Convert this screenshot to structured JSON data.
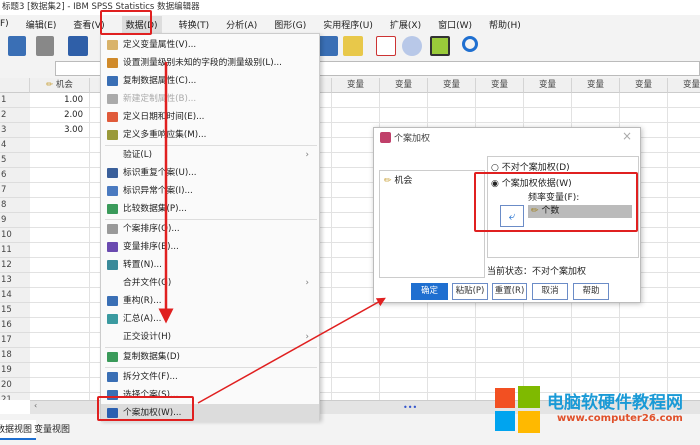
{
  "title": "标题3 [数据集2] - IBM SPSS Statistics 数据编辑器",
  "menubar": [
    "F)",
    "编辑(E)",
    "查看(V)",
    "数据(D)",
    "转换(T)",
    "分析(A)",
    "图形(G)",
    "实用程序(U)",
    "扩展(X)",
    "窗口(W)",
    "帮助(H)"
  ],
  "grid": {
    "col1": "机会",
    "var_label": "变量",
    "rows": [
      "1",
      "2",
      "3",
      "4",
      "5",
      "6",
      "7",
      "8",
      "9",
      "10",
      "11",
      "12",
      "13",
      "14",
      "15",
      "16",
      "17",
      "18",
      "19",
      "20",
      "21"
    ],
    "values": [
      "1.00",
      "2.00",
      "3.00"
    ]
  },
  "data_menu": {
    "items": [
      {
        "label": "定义变量属性(V)...",
        "icon": "define-variable-icon",
        "color": "#d9b36a"
      },
      {
        "label": "设置测量级别未知的字段的测量级别(L)...",
        "icon": "measurement-level-icon",
        "color": "#d08a2a"
      },
      {
        "label": "复制数据属性(C)...",
        "icon": "copy-properties-icon",
        "color": "#3a6fb5"
      },
      {
        "label": "新建定制属性(B)...",
        "icon": "custom-attribute-icon",
        "color": "#aaa",
        "disabled": true
      },
      {
        "label": "定义日期和时间(E)...",
        "icon": "date-time-icon",
        "color": "#e05a3a"
      },
      {
        "label": "定义多重响应集(M)...",
        "icon": "multiple-response-icon",
        "color": "#9a9a3a"
      },
      {
        "label": "验证(L)",
        "submenu": true
      },
      {
        "label": "标识重复个案(U)...",
        "icon": "duplicate-cases-icon",
        "color": "#3a5f9a"
      },
      {
        "label": "标识异常个案(I)...",
        "icon": "unusual-cases-icon",
        "color": "#4a7ac0"
      },
      {
        "label": "比较数据集(P)...",
        "icon": "compare-datasets-icon",
        "color": "#3a9a5a"
      },
      {
        "label": "个案排序(O)...",
        "icon": "sort-cases-icon",
        "color": "#999"
      },
      {
        "label": "变量排序(B)...",
        "icon": "sort-variables-icon",
        "color": "#6a4ab0"
      },
      {
        "label": "转置(N)...",
        "icon": "transpose-icon",
        "color": "#3a8a9a"
      },
      {
        "label": "合并文件(G)",
        "submenu": true
      },
      {
        "label": "重构(R)...",
        "icon": "restructure-icon",
        "color": "#3a6fb5"
      },
      {
        "label": "汇总(A)...",
        "icon": "aggregate-icon",
        "color": "#3a9aa0"
      },
      {
        "label": "正交设计(H)",
        "submenu": true
      },
      {
        "label": "复制数据集(D)",
        "icon": "copy-dataset-icon",
        "color": "#3a9a5a"
      },
      {
        "label": "拆分文件(F)...",
        "icon": "split-file-icon",
        "color": "#3a6fb5"
      },
      {
        "label": "选择个案(S)...",
        "icon": "select-cases-icon",
        "color": "#3a6fb5"
      },
      {
        "label": "个案加权(W)...",
        "icon": "weight-cases-icon",
        "color": "#2a5fb0",
        "highlighted": true
      }
    ]
  },
  "dialog": {
    "title": "个案加权",
    "source_var": "机会",
    "opt_none": "不对个案加权(D)",
    "opt_weight": "个案加权依据(W)",
    "freq_label": "频率变量(F):",
    "freq_value": "个数",
    "status": "当前状态：不对个案加权",
    "buttons": {
      "ok": "确定",
      "paste": "粘贴(P)",
      "reset": "重置(R)",
      "cancel": "取消",
      "help": "帮助"
    }
  },
  "tabs": {
    "data_view": "数据视图",
    "variable_view": "变量视图"
  },
  "watermark": {
    "title": "电脑软硬件教程网",
    "url": "www.computer26.com"
  },
  "colors": {
    "accent": "#1f6fd0",
    "highlight_red": "#e02020"
  }
}
